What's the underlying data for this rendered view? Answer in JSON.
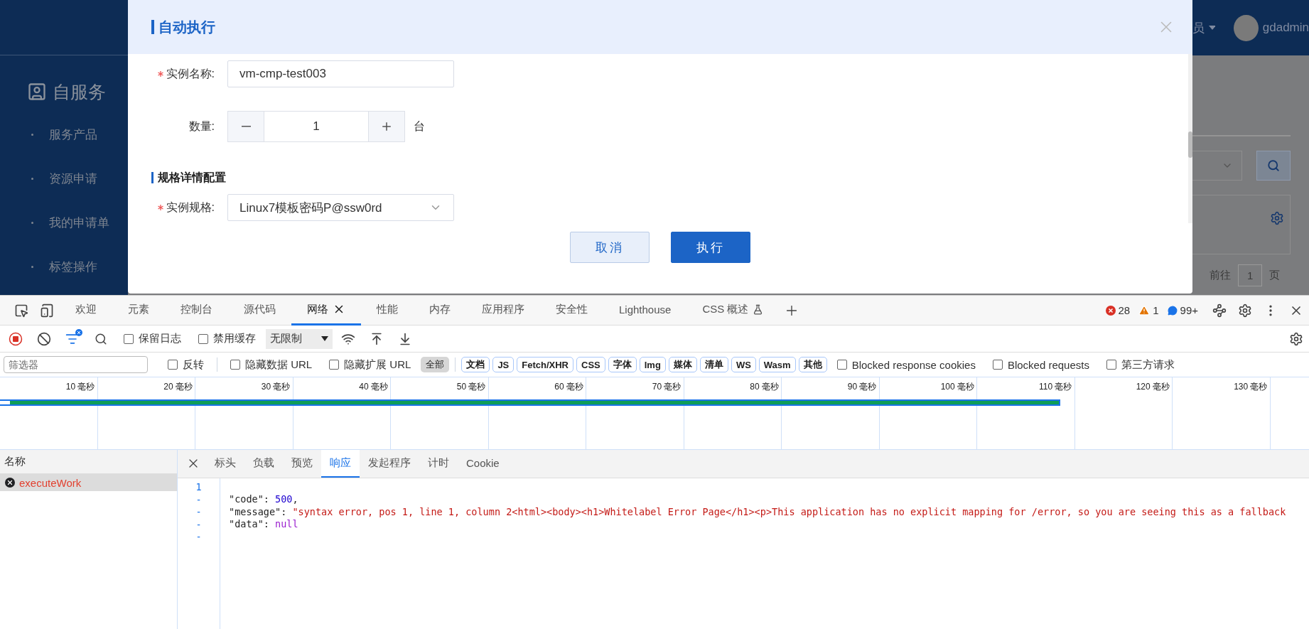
{
  "app": {
    "sidebar": {
      "title": "自服务",
      "items": [
        "服务产品",
        "资源申请",
        "我的申请单",
        "标签操作"
      ]
    },
    "header": {
      "role": "员",
      "user": "gdadmin"
    },
    "pager": [
      "前往",
      "1",
      "页"
    ]
  },
  "dialog": {
    "title": "自动执行",
    "fields": [
      {
        "kind": "text",
        "label": "实例名称:",
        "required": true,
        "value": "vm-cmp-test003"
      },
      {
        "kind": "stepper",
        "label": "数量:",
        "required": false,
        "value": "1",
        "unit": "台"
      }
    ],
    "section": "规格详情配置",
    "section_fields": [
      {
        "kind": "select",
        "label": "实例规格:",
        "required": true,
        "value": "Linux7模板密码P@ssw0rd"
      }
    ],
    "buttons": [
      {
        "label": "取消",
        "kind": "secondary"
      },
      {
        "label": "执行",
        "kind": "primary"
      }
    ]
  },
  "devtools": {
    "tabs": [
      {
        "label": "欢迎",
        "selected": false,
        "closable": false,
        "experimental": false
      },
      {
        "label": "元素",
        "selected": false,
        "closable": false,
        "experimental": false
      },
      {
        "label": "控制台",
        "selected": false,
        "closable": false,
        "experimental": false
      },
      {
        "label": "源代码",
        "selected": false,
        "closable": false,
        "experimental": false
      },
      {
        "label": "网络",
        "selected": true,
        "closable": true,
        "experimental": false
      },
      {
        "label": "性能",
        "selected": false,
        "closable": false,
        "experimental": false
      },
      {
        "label": "内存",
        "selected": false,
        "closable": false,
        "experimental": false
      },
      {
        "label": "应用程序",
        "selected": false,
        "closable": false,
        "experimental": false
      },
      {
        "label": "安全性",
        "selected": false,
        "closable": false,
        "experimental": false
      },
      {
        "label": "Lighthouse",
        "selected": false,
        "closable": false,
        "experimental": false
      },
      {
        "label": "CSS 概述",
        "selected": false,
        "closable": false,
        "experimental": true
      }
    ],
    "counts": {
      "errors": "28",
      "warnings": "1",
      "messages": "99+"
    },
    "toolbar": {
      "recording": true,
      "filter_active": true,
      "checks": [
        {
          "label": "保留日志",
          "checked": false
        },
        {
          "label": "禁用缓存",
          "checked": false
        }
      ],
      "throttling": "无限制"
    },
    "filter": {
      "placeholder": "筛选器",
      "invert": {
        "label": "反转",
        "checked": false
      },
      "hide": [
        {
          "label": "隐藏数据 URL",
          "checked": false
        },
        {
          "label": "隐藏扩展 URL",
          "checked": false
        }
      ],
      "all": {
        "label": "全部",
        "selected": true
      },
      "types": [
        {
          "label": "文档",
          "selected": false
        },
        {
          "label": "JS",
          "selected": false
        },
        {
          "label": "Fetch/XHR",
          "selected": false
        },
        {
          "label": "CSS",
          "selected": false
        },
        {
          "label": "字体",
          "selected": false
        },
        {
          "label": "Img",
          "selected": false
        },
        {
          "label": "媒体",
          "selected": false
        },
        {
          "label": "清单",
          "selected": false
        },
        {
          "label": "WS",
          "selected": false
        },
        {
          "label": "Wasm",
          "selected": false
        },
        {
          "label": "其他",
          "selected": false
        }
      ],
      "more": [
        {
          "label": "Blocked response cookies",
          "checked": false
        },
        {
          "label": "Blocked requests",
          "checked": false
        },
        {
          "label": "第三方请求",
          "checked": false
        }
      ]
    },
    "timeline": {
      "ticks": [
        "10 毫秒",
        "20 毫秒",
        "30 毫秒",
        "40 毫秒",
        "50 毫秒",
        "60 毫秒",
        "70 毫秒",
        "80 毫秒",
        "90 毫秒",
        "100 毫秒",
        "110 毫秒",
        "120 毫秒",
        "130 毫秒"
      ],
      "level": 0.81
    },
    "requests": {
      "header": "名称",
      "items": [
        {
          "name": "executeWork",
          "failed": true,
          "selected": true
        }
      ]
    },
    "detail": {
      "tabs": [
        {
          "label": "标头",
          "selected": false
        },
        {
          "label": "负载",
          "selected": false
        },
        {
          "label": "预览",
          "selected": false
        },
        {
          "label": "响应",
          "selected": true
        },
        {
          "label": "发起程序",
          "selected": false
        },
        {
          "label": "计时",
          "selected": false
        },
        {
          "label": "Cookie",
          "selected": false
        }
      ],
      "gutter": [
        "1",
        "-",
        "-",
        "-",
        "-"
      ],
      "lines": [
        [
          {
            "t": "\"code\": ",
            "kind": "key"
          },
          {
            "t": "500",
            "kind": "number"
          },
          {
            "t": ",",
            "kind": "punct"
          }
        ],
        [
          {
            "t": "\"message\": ",
            "kind": "key"
          },
          {
            "t": "\"syntax error, pos 1, line 1, column 2<html><body><h1>Whitelabel Error Page</h1><p>This application has no explicit mapping for /error, so you are seeing this as a fallback",
            "kind": "string"
          }
        ],
        [
          {
            "t": "\"data\": ",
            "kind": "key"
          },
          {
            "t": "null",
            "kind": "null"
          }
        ]
      ]
    }
  }
}
